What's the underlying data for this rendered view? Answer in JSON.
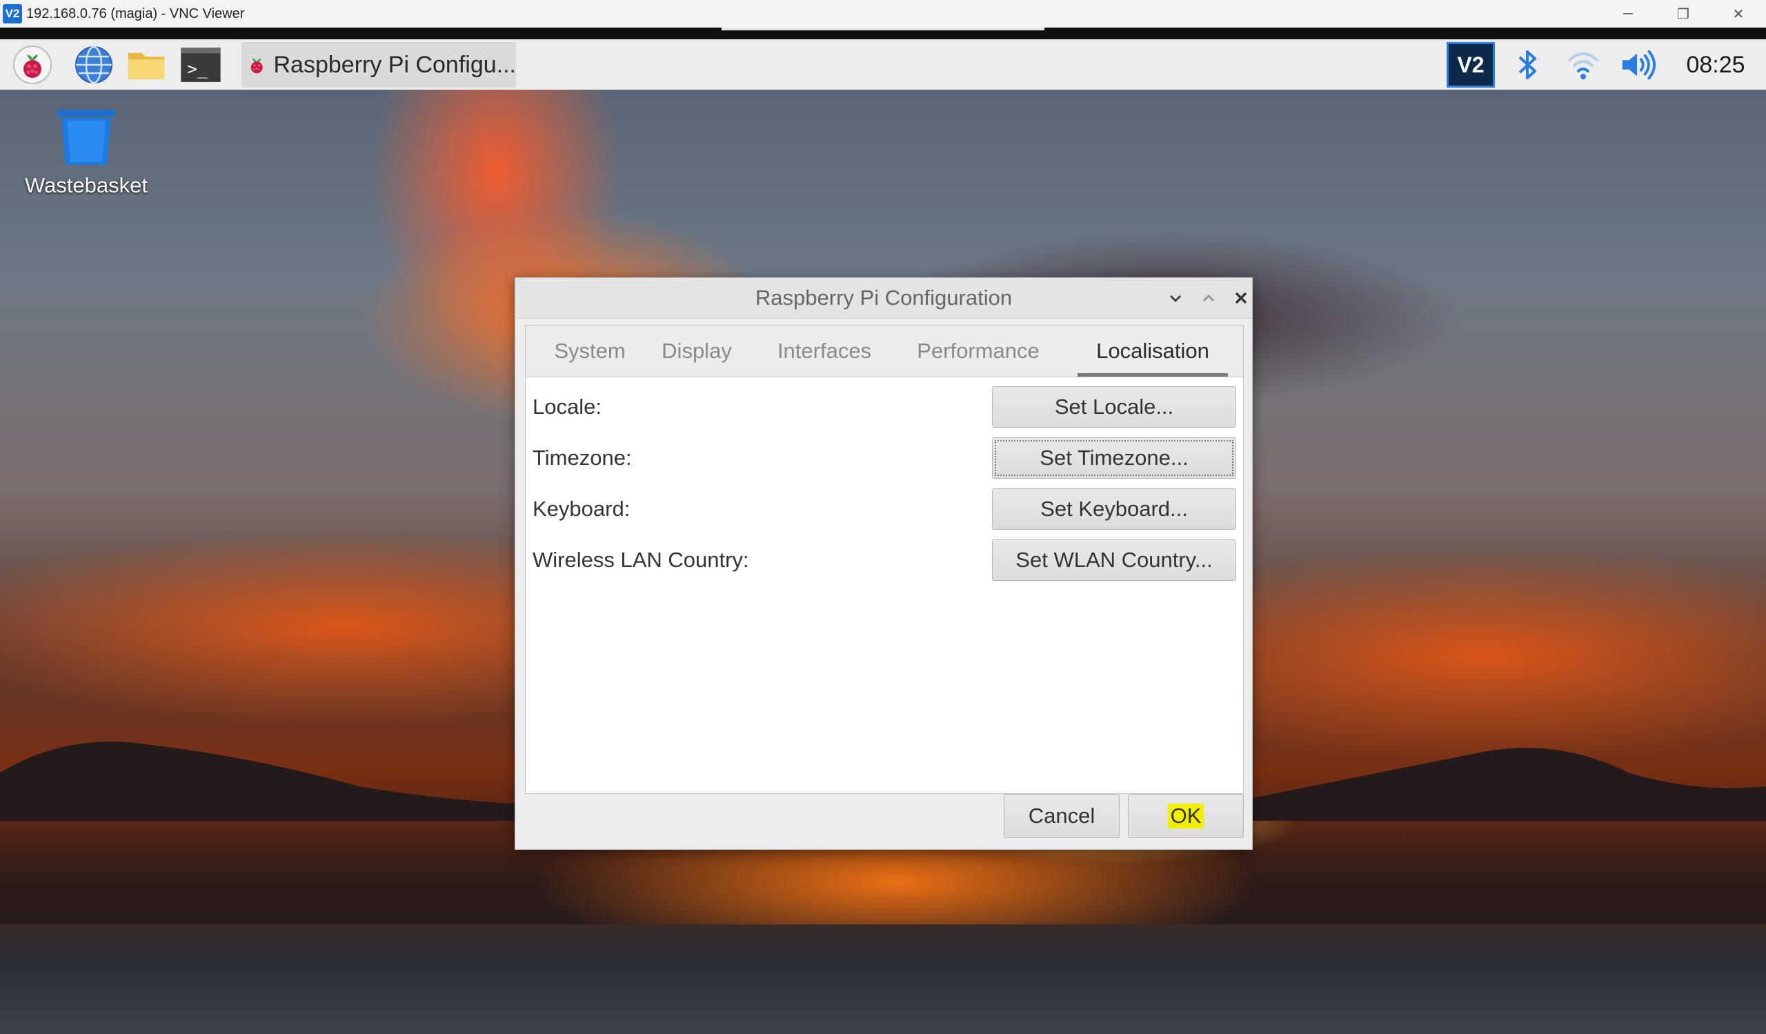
{
  "vnc_window": {
    "title": "192.168.0.76 (magia) - VNC Viewer",
    "logo_text": "V2",
    "controls": {
      "minimize": "─",
      "restore": "❐",
      "close": "✕"
    }
  },
  "taskbar": {
    "task_label": "Raspberry Pi Configu...",
    "vnc_tray_label": "V2",
    "clock": "08:25",
    "icons": [
      "raspberry-menu-icon",
      "web-browser-icon",
      "file-manager-icon",
      "terminal-icon",
      "bluetooth-icon",
      "wifi-icon",
      "volume-icon"
    ],
    "terminal_glyph": ">_"
  },
  "desktop": {
    "wastebasket_label": "Wastebasket"
  },
  "dialog": {
    "title": "Raspberry Pi Configuration",
    "tabs": [
      {
        "label": "System",
        "active": false
      },
      {
        "label": "Display",
        "active": false
      },
      {
        "label": "Interfaces",
        "active": false
      },
      {
        "label": "Performance",
        "active": false
      },
      {
        "label": "Localisation",
        "active": true
      }
    ],
    "rows": [
      {
        "label": "Locale:",
        "button": "Set Locale..."
      },
      {
        "label": "Timezone:",
        "button": "Set Timezone..."
      },
      {
        "label": "Keyboard:",
        "button": "Set Keyboard..."
      },
      {
        "label": "Wireless LAN Country:",
        "button": "Set WLAN Country..."
      }
    ],
    "cancel_label": "Cancel",
    "ok_label": "OK"
  },
  "colors": {
    "accent_vnc": "#2b7de0",
    "highlight_ok": "#f2ee00",
    "taskbar_bg": "#ededed",
    "dialog_bg": "#ededed"
  }
}
